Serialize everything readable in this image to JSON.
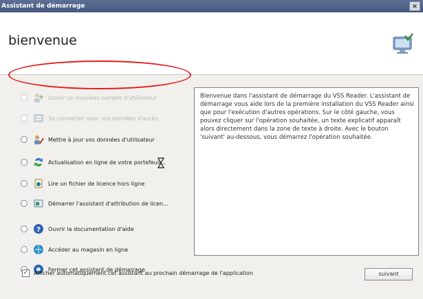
{
  "window": {
    "title": "Assistant de démarrage",
    "close_label": "×"
  },
  "header": {
    "title": "bienvenue",
    "logo_icon": "monitor-check-icon"
  },
  "options": [
    {
      "label": "Ouvrir un nouveau compte d'utilisateur",
      "icon": "user-add-icon",
      "enabled": false,
      "highlighted": true
    },
    {
      "label": "Se connecter avec vos données d'accès",
      "icon": "login-icon",
      "enabled": false
    },
    {
      "label": "Mettre à jour vos données d'utilisateur",
      "icon": "user-edit-icon",
      "enabled": true
    },
    {
      "label": "Actualisation en ligne de votre portefeuil...",
      "icon": "refresh-icon",
      "enabled": true
    },
    {
      "label": "Lire un fichier de licence hors ligne",
      "icon": "license-file-icon",
      "enabled": true
    },
    {
      "label": "Démarrer l'assistant d'attribution de licen...",
      "icon": "license-wizard-icon",
      "enabled": true
    },
    {
      "label": "Ouvrir la documentation d'aide",
      "icon": "help-icon",
      "enabled": true
    },
    {
      "label": "Accéder au magasin en ligne",
      "icon": "shop-icon",
      "enabled": true
    },
    {
      "label": "Fermer cet assistant de démarrage",
      "icon": "close-wizard-icon",
      "enabled": true
    }
  ],
  "description": "Bienvenue dans l'assistant de démarrage du VSS Reader. L'assistant de démarrage vous aide lors de la première installation du VSS Reader ainsi que pour l'exécution d'autres opérations. Sur le côté gauche, vous pouvez cliquer sur l'opération souhaitée, un texte explicatif apparaît alors directement dans la zone de texte à droite. Avec le bouton 'suivant' au-dessous, vous démarrez l'opération souhaitée.",
  "footer": {
    "checkbox_label": "Afficher automatiquement cet assistant au prochain démarrage de l'application",
    "checkbox_checked": true,
    "next_label": "suivant"
  },
  "colors": {
    "annotation": "#e51b1b",
    "titlebar": "#4f628a"
  }
}
